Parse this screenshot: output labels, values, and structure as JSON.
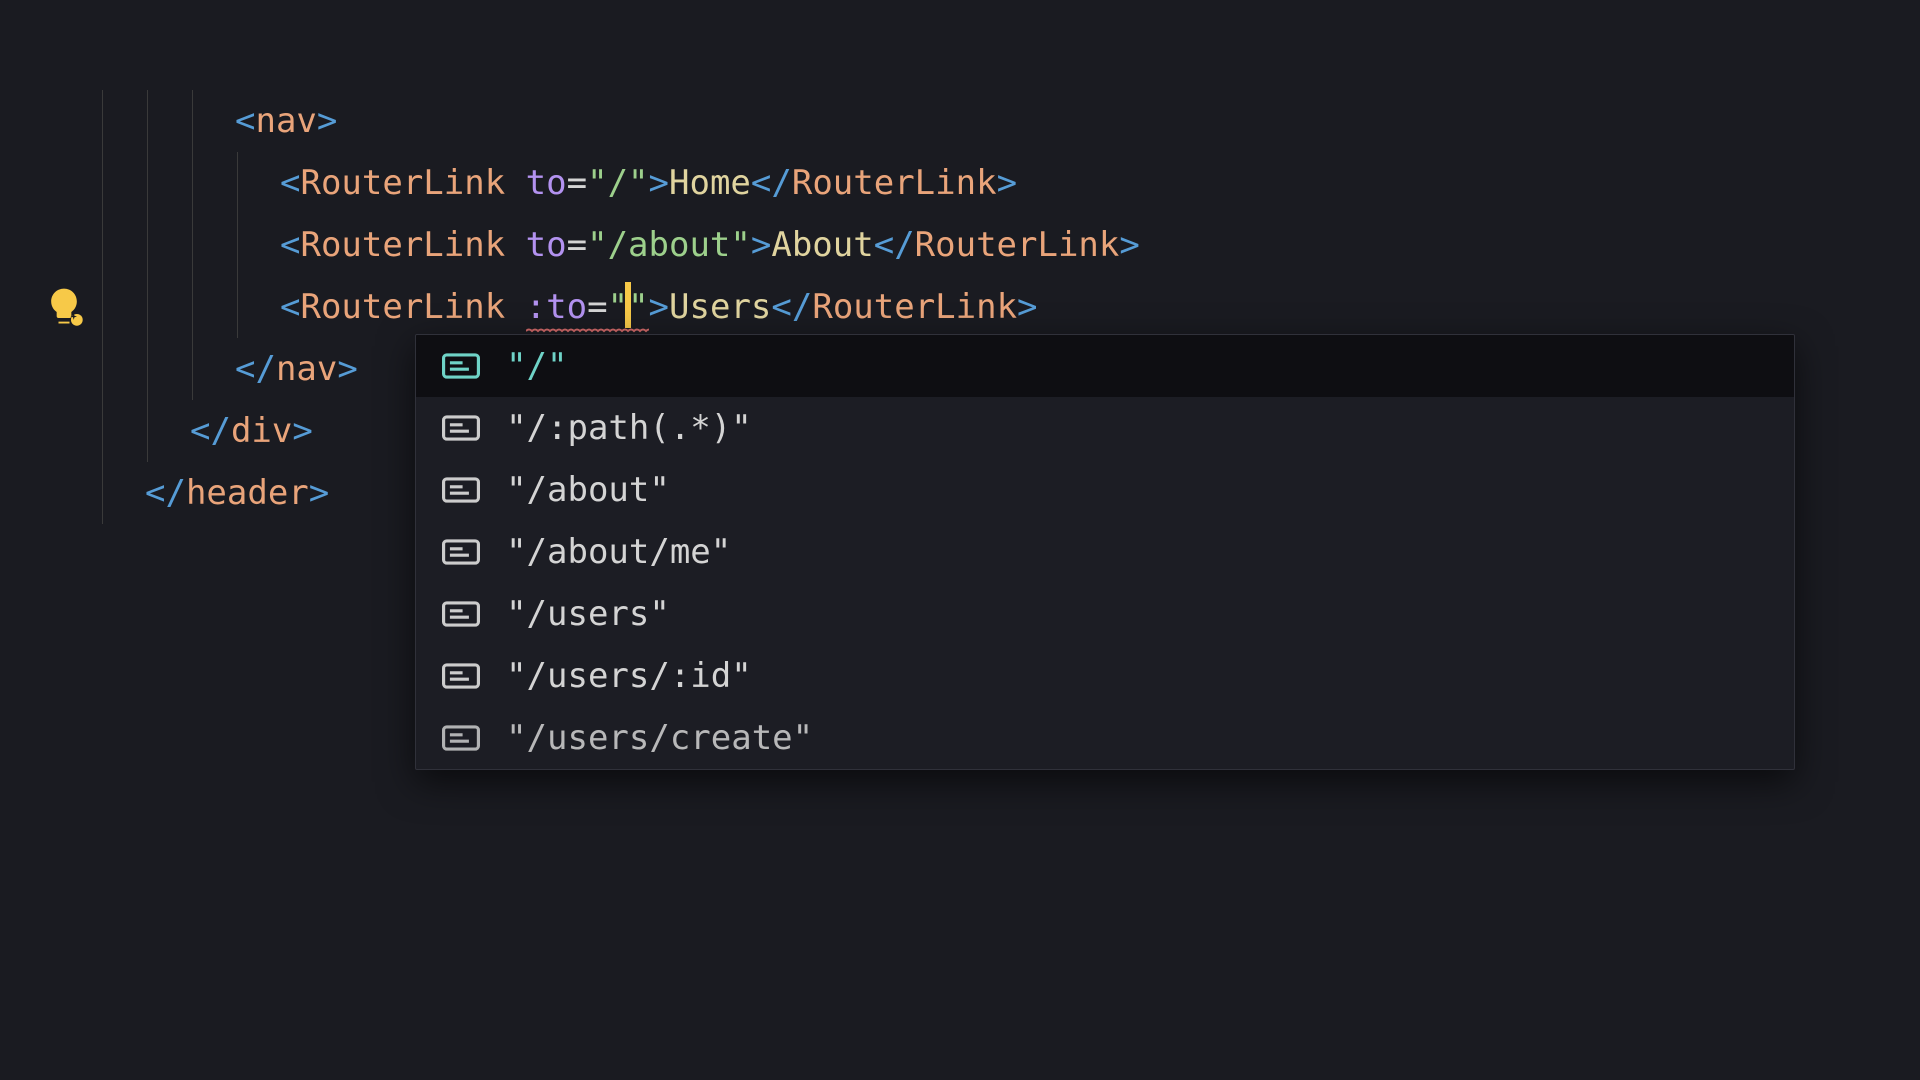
{
  "colors": {
    "background": "#1a1b21",
    "active_line": "#24252d",
    "bracket": "#569cd6",
    "tag": "#e9a47a",
    "attr": "#b392f0",
    "string": "#9dd08c",
    "text_content": "#e0d49f",
    "cursor": "#f7c948",
    "suggestion_selected_fg": "#6fd3c7",
    "lightbulb": "#f7c948"
  },
  "editor": {
    "gutter": {
      "lightbulb_icon": "quickfix-lightbulb-icon"
    },
    "lines": [
      {
        "indent": 3,
        "tokens": [
          {
            "t": "<",
            "c": "bracket"
          },
          {
            "t": "nav",
            "c": "tag"
          },
          {
            "t": ">",
            "c": "bracket"
          }
        ]
      },
      {
        "indent": 4,
        "tokens": [
          {
            "t": "<",
            "c": "bracket"
          },
          {
            "t": "RouterLink",
            "c": "tag"
          },
          {
            "t": " ",
            "c": "punct"
          },
          {
            "t": "to",
            "c": "attr"
          },
          {
            "t": "=",
            "c": "punct"
          },
          {
            "t": "\"/\"",
            "c": "str"
          },
          {
            "t": ">",
            "c": "bracket"
          },
          {
            "t": "Home",
            "c": "text"
          },
          {
            "t": "</",
            "c": "bracket"
          },
          {
            "t": "RouterLink",
            "c": "tag"
          },
          {
            "t": ">",
            "c": "bracket"
          }
        ]
      },
      {
        "indent": 4,
        "tokens": [
          {
            "t": "<",
            "c": "bracket"
          },
          {
            "t": "RouterLink",
            "c": "tag"
          },
          {
            "t": " ",
            "c": "punct"
          },
          {
            "t": "to",
            "c": "attr"
          },
          {
            "t": "=",
            "c": "punct"
          },
          {
            "t": "\"/about\"",
            "c": "str"
          },
          {
            "t": ">",
            "c": "bracket"
          },
          {
            "t": "About",
            "c": "text"
          },
          {
            "t": "</",
            "c": "bracket"
          },
          {
            "t": "RouterLink",
            "c": "tag"
          },
          {
            "t": ">",
            "c": "bracket"
          }
        ]
      },
      {
        "indent": 4,
        "active": true,
        "lightbulb": true,
        "cursor_in_string": true,
        "squiggle_on": ":to=\"\"",
        "tokens": [
          {
            "t": "<",
            "c": "bracket"
          },
          {
            "t": "RouterLink",
            "c": "tag"
          },
          {
            "t": " ",
            "c": "punct"
          },
          {
            "t": ":to",
            "c": "attr"
          },
          {
            "t": "=",
            "c": "punct"
          },
          {
            "t": "\"",
            "c": "str"
          },
          {
            "t": "\"",
            "c": "str",
            "cursor_before": true
          },
          {
            "t": ">",
            "c": "bracket"
          },
          {
            "t": "Users",
            "c": "text"
          },
          {
            "t": "</",
            "c": "bracket"
          },
          {
            "t": "RouterLink",
            "c": "tag"
          },
          {
            "t": ">",
            "c": "bracket"
          }
        ]
      },
      {
        "indent": 3,
        "tokens": [
          {
            "t": "</",
            "c": "bracket"
          },
          {
            "t": "nav",
            "c": "tag"
          },
          {
            "t": ">",
            "c": "bracket"
          }
        ]
      },
      {
        "indent": 2,
        "tokens": [
          {
            "t": "</",
            "c": "bracket"
          },
          {
            "t": "div",
            "c": "tag"
          },
          {
            "t": ">",
            "c": "bracket"
          }
        ]
      },
      {
        "indent": 1,
        "tokens": [
          {
            "t": "</",
            "c": "bracket"
          },
          {
            "t": "header",
            "c": "tag"
          },
          {
            "t": ">",
            "c": "bracket"
          }
        ]
      }
    ]
  },
  "suggestions": {
    "items": [
      {
        "label": "\"/\"",
        "selected": true
      },
      {
        "label": "\"/:path(.*)\""
      },
      {
        "label": "\"/about\""
      },
      {
        "label": "\"/about/me\""
      },
      {
        "label": "\"/users\""
      },
      {
        "label": "\"/users/:id\""
      },
      {
        "label": "\"/users/create\"",
        "partial": true
      }
    ]
  }
}
